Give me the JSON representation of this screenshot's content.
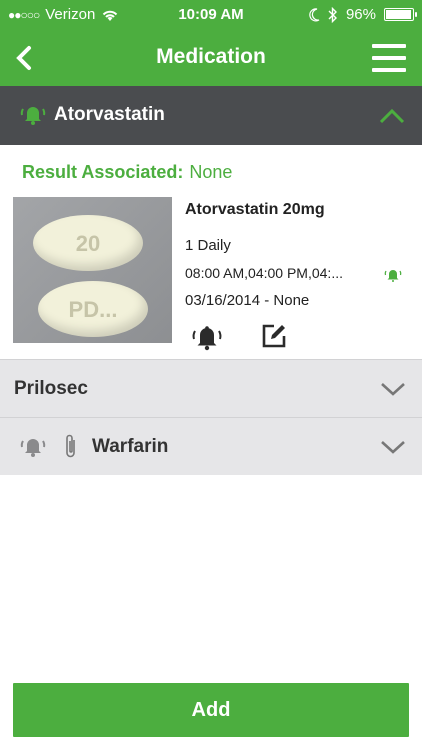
{
  "status_bar": {
    "carrier": "Verizon",
    "time": "10:09 AM",
    "battery": "96%",
    "battery_level": 0.96
  },
  "nav": {
    "title": "Medication",
    "back_icon": "chevron-left-icon",
    "menu_icon": "hamburger-menu-icon"
  },
  "expanded": {
    "name": "Atorvastatin",
    "result_label": "Result Associated:",
    "result_value": "None",
    "dose": "Atorvastatin 20mg",
    "frequency": "1 Daily",
    "times": "08:00 AM,04:00 PM,04:...",
    "date_range": "03/16/2014 - None",
    "pill_text_top": "20",
    "pill_text_bottom": "PD..."
  },
  "medications": [
    {
      "name": "Prilosec"
    },
    {
      "name": "Warfarin"
    }
  ],
  "add_button": "Add",
  "colors": {
    "accent": "#4cae3f",
    "section_dark": "#4a4c4f",
    "row_bg": "#e6e6e8"
  }
}
